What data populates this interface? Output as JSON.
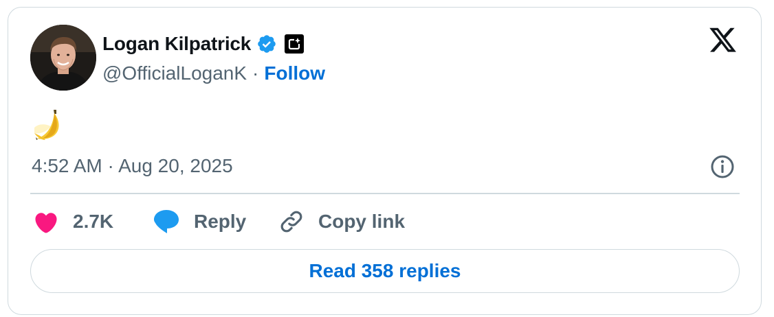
{
  "author": {
    "name": "Logan Kilpatrick",
    "handle": "@OfficialLoganK",
    "separator": "·",
    "follow_label": "Follow",
    "verified_icon": "verified-badge-icon",
    "affiliation_icon": "affiliate-badge-icon"
  },
  "brand": {
    "logo_icon": "x-logo-icon"
  },
  "tweet": {
    "content_icon": "banana-emoji",
    "timestamp": "4:52 AM · Aug 20, 2025"
  },
  "actions": {
    "likes_count": "2.7K",
    "reply_label": "Reply",
    "copy_link_label": "Copy link"
  },
  "footer": {
    "read_replies_label": "Read 358 replies"
  },
  "colors": {
    "link_blue": "#006fd6",
    "verified_blue": "#1d9bf0",
    "heart_pink": "#f91880",
    "reply_blue": "#1d9bf0",
    "muted_text": "#536471",
    "border": "#cfd9de"
  }
}
